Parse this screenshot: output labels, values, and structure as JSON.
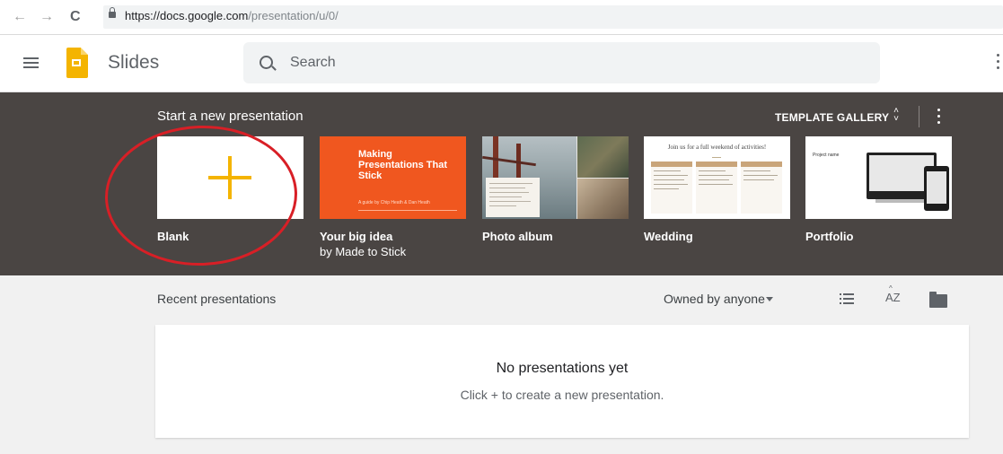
{
  "browser": {
    "back_icon": "←",
    "forward_icon": "→",
    "reload_icon": "C",
    "url_host": "https://docs.google.com",
    "url_path": "/presentation/u/0/"
  },
  "header": {
    "app_title": "Slides",
    "search_placeholder": "Search"
  },
  "templates": {
    "heading": "Start a new presentation",
    "gallery_label": "TEMPLATE GALLERY",
    "items": [
      {
        "label": "Blank",
        "sub": ""
      },
      {
        "label": "Your big idea",
        "sub": "by Made to Stick",
        "thumb_title": "Making Presentations That Stick",
        "thumb_sub": "A guide by Chip Heath & Dan Heath"
      },
      {
        "label": "Photo album",
        "sub": ""
      },
      {
        "label": "Wedding",
        "sub": "",
        "thumb_title": "Join us for a full weekend of activities!"
      },
      {
        "label": "Portfolio",
        "sub": "",
        "thumb_title": "Project name"
      }
    ]
  },
  "recent": {
    "heading": "Recent presentations",
    "owner_filter": "Owned by anyone",
    "sort_icon": "AZ",
    "empty_title": "No presentations yet",
    "empty_hint": "Click + to create a new presentation."
  },
  "colors": {
    "band": "#4a4543",
    "accent_yellow": "#f4b400",
    "annotation_red": "#d81f26",
    "big_idea_orange": "#f0571f"
  }
}
